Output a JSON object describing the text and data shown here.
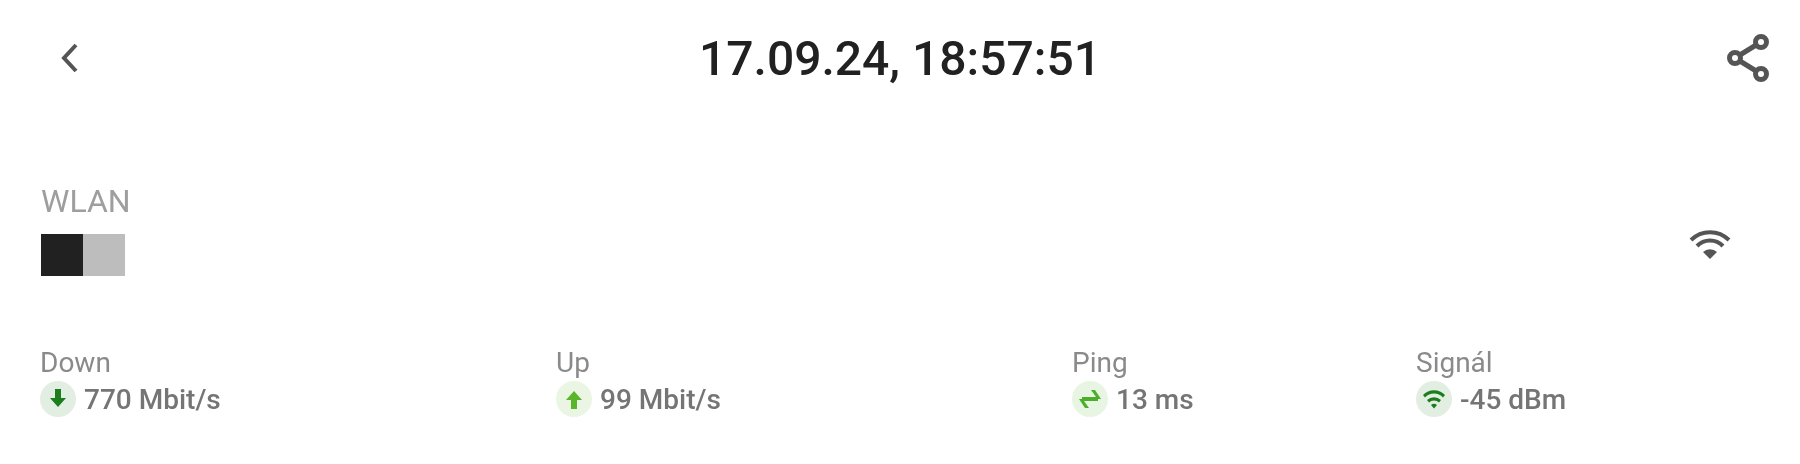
{
  "header": {
    "title": "17.09.24, 18:57:51"
  },
  "connection": {
    "label": "WLAN",
    "segments": [
      {
        "color": "#212121"
      },
      {
        "color": "#bdbdbd"
      }
    ]
  },
  "metrics": [
    {
      "kind": "down",
      "label": "Down",
      "value": "770 Mbit/s",
      "color": "#1b7d1b"
    },
    {
      "kind": "up",
      "label": "Up",
      "value": "99 Mbit/s",
      "color": "#5ab52a"
    },
    {
      "kind": "ping",
      "label": "Ping",
      "value": "13 ms",
      "color": "#4caf2a"
    },
    {
      "kind": "signal",
      "label": "Signál",
      "value": "-45 dBm",
      "color": "#1b7d1b"
    }
  ]
}
